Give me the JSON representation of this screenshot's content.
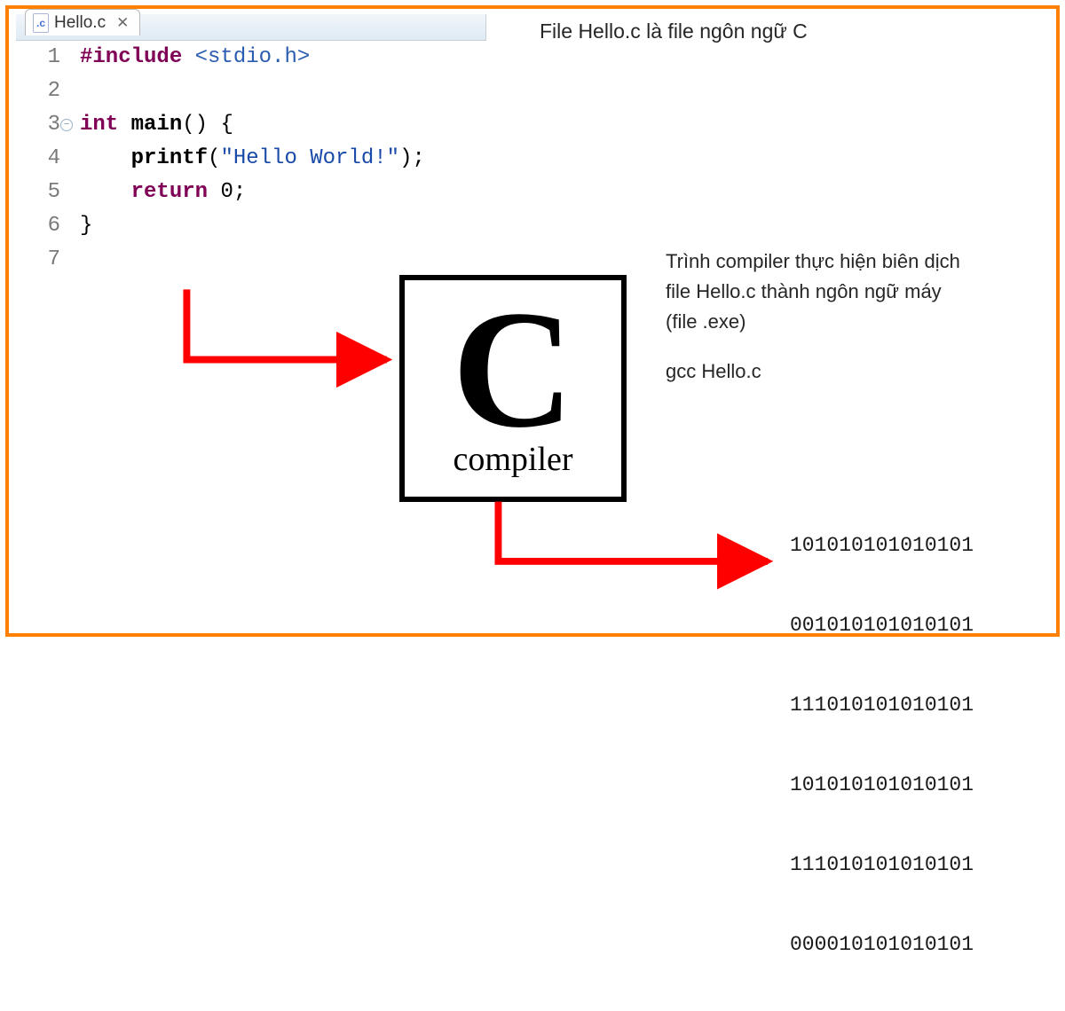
{
  "tab": {
    "filename": "Hello.c",
    "icon_text": ".c"
  },
  "code": {
    "lines": [
      {
        "n": "1",
        "text": "#include <stdio.h>"
      },
      {
        "n": "2",
        "text": ""
      },
      {
        "n": "3",
        "text": "int main() {"
      },
      {
        "n": "4",
        "text": "    printf(\"Hello World!\");"
      },
      {
        "n": "5",
        "text": "    return 0;"
      },
      {
        "n": "6",
        "text": "}"
      },
      {
        "n": "7",
        "text": ""
      }
    ]
  },
  "annotations": {
    "top": "File Hello.c là file ngôn ngữ C",
    "mid_lines": [
      "Trình compiler thực hiện biên dịch",
      "file Hello.c thành ngôn ngữ máy",
      "(file .exe)"
    ],
    "command": "gcc Hello.c"
  },
  "compiler": {
    "letter": "C",
    "caption": "compiler"
  },
  "binary_lines": [
    "101010101010101",
    "001010101010101",
    "111010101010101",
    "101010101010101",
    "111010101010101",
    "000010101010101"
  ],
  "colors": {
    "frame_border": "#ff7f00",
    "arrow": "#ff0000",
    "keyword": "#7f0055",
    "string": "#1a4aa8"
  }
}
